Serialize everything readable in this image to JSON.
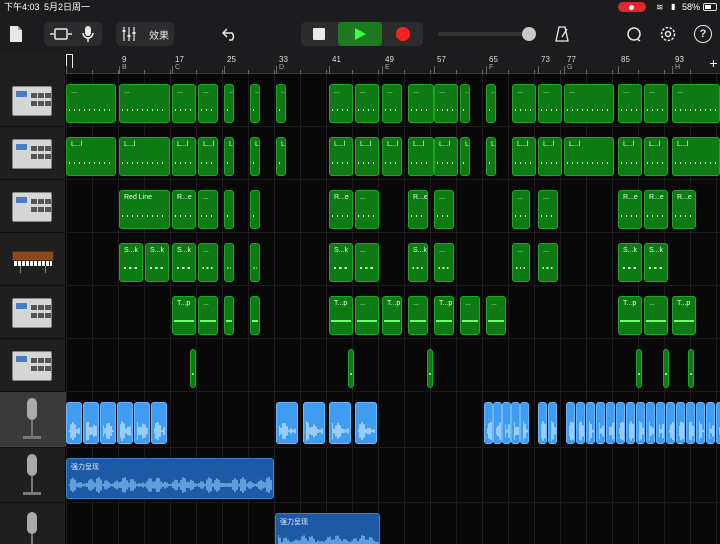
{
  "status_bar": {
    "time": "下午4:03",
    "date": "5月2日周一",
    "battery": "58%"
  },
  "toolbar": {
    "effects_label": "效果",
    "help_label": "?"
  },
  "ruler": {
    "bars": [
      {
        "num": "",
        "sect": ""
      },
      {
        "num": "9",
        "sect": "B"
      },
      {
        "num": "17",
        "sect": "C"
      },
      {
        "num": "25",
        "sect": ""
      },
      {
        "num": "33",
        "sect": "D"
      },
      {
        "num": "41",
        "sect": ""
      },
      {
        "num": "49",
        "sect": "E"
      },
      {
        "num": "57",
        "sect": ""
      },
      {
        "num": "65",
        "sect": "F"
      },
      {
        "num": "73",
        "sect": ""
      },
      {
        "num": "77",
        "sect": "G"
      },
      {
        "num": "85",
        "sect": ""
      },
      {
        "num": "93",
        "sect": "H"
      }
    ],
    "add_label": "+"
  },
  "tracks": [
    {
      "name": "drum-machine-1",
      "instrument": "drum-machine"
    },
    {
      "name": "drum-machine-2",
      "instrument": "drum-machine"
    },
    {
      "name": "drum-machine-3",
      "instrument": "drum-machine"
    },
    {
      "name": "synth",
      "instrument": "keyboard"
    },
    {
      "name": "drum-machine-4",
      "instrument": "drum-machine"
    },
    {
      "name": "drum-machine-5",
      "instrument": "drum-machine"
    },
    {
      "name": "audio-recorder-1",
      "instrument": "microphone",
      "selected": true
    },
    {
      "name": "audio-recorder-2",
      "instrument": "microphone"
    },
    {
      "name": "audio-recorder-3",
      "instrument": "microphone"
    }
  ],
  "region_labels": {
    "ellipsis": "...",
    "loop": "L...l",
    "red_line": "Red Line",
    "re": "R...e",
    "sk": "S...k",
    "tp": "T...p",
    "audio_strong": "强力呈现"
  },
  "colors": {
    "midi_region": "#0d7a14",
    "audio_region": "#3e9df0",
    "recorded_region": "#1d5aa6",
    "play": "#1c7a20",
    "record": "#ff1f1f"
  }
}
